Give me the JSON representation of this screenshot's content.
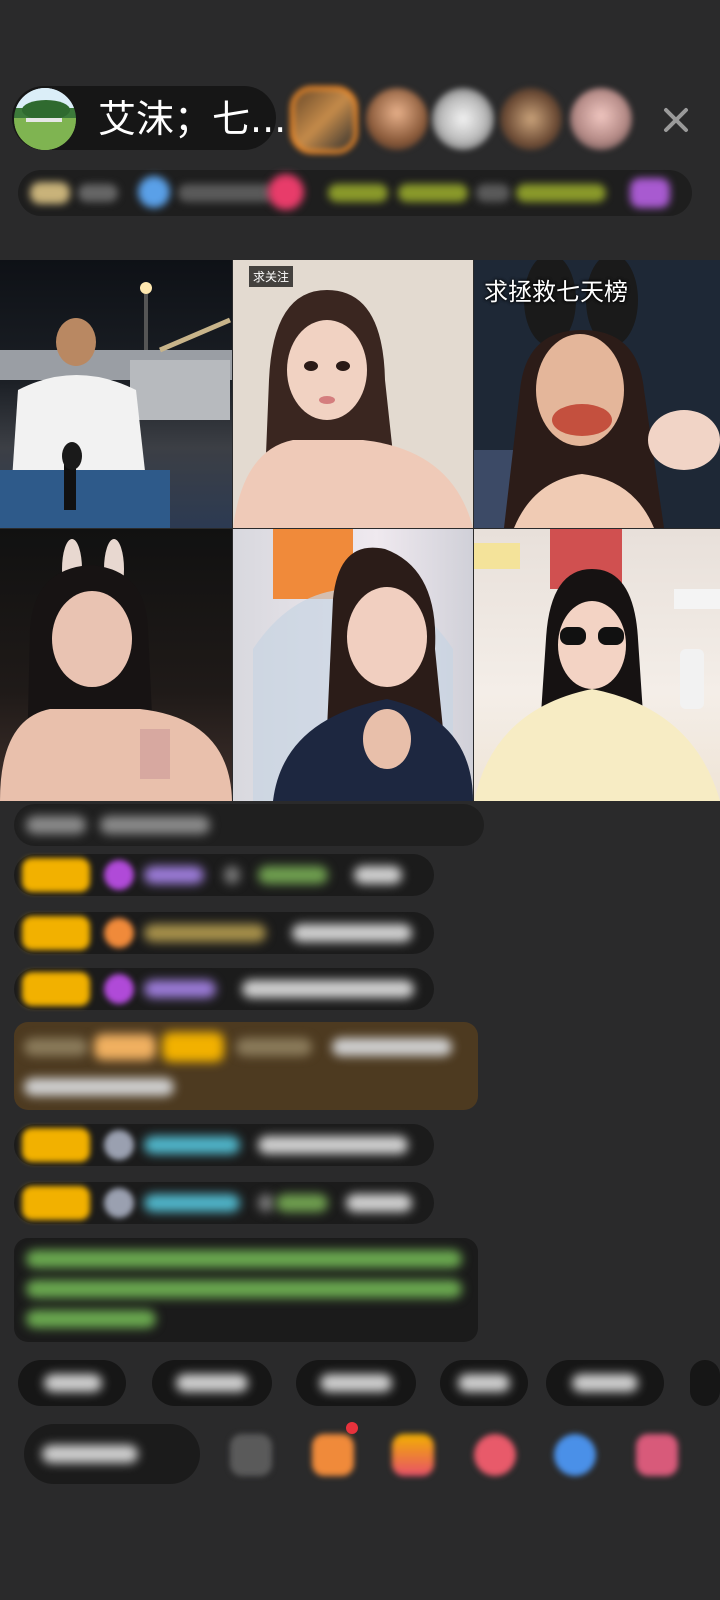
{
  "header": {
    "host_name": "艾沫；七...",
    "close_icon": "close-icon",
    "viewer_count": 5
  },
  "tiles": [
    {
      "label": ""
    },
    {
      "label": "求关注"
    },
    {
      "label": "求拯救七天榜"
    },
    {
      "label": ""
    },
    {
      "label": ""
    },
    {
      "label": ""
    }
  ],
  "colors": {
    "background": "#2a2a2b",
    "badge": "#f2b100",
    "accent_orange": "#f18a27",
    "gift_purple": "#b04ad8",
    "chat_green": "#7bbf59",
    "chat_blue": "#4fb4c8"
  }
}
